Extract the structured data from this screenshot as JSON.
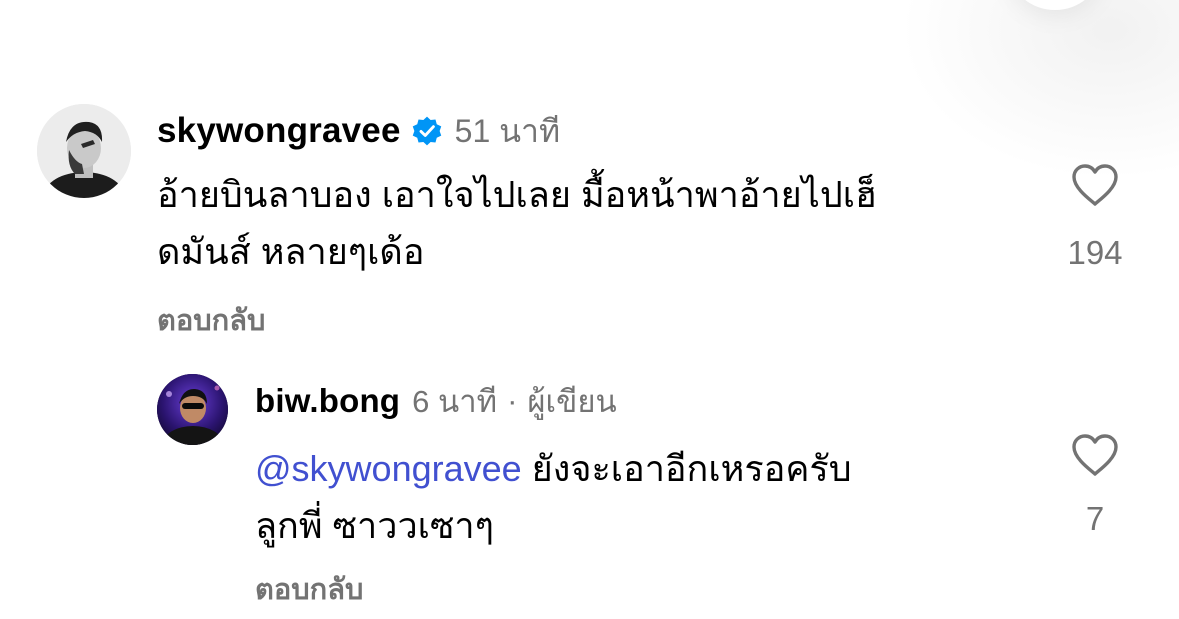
{
  "colors": {
    "text_primary": "#000000",
    "text_secondary": "#737373",
    "mention": "#4150d0",
    "verified_badge": "#0095f6"
  },
  "comment": {
    "username": "skywongravee",
    "verified": true,
    "verified_icon": "verified-badge-icon",
    "time": "51 นาที",
    "text_line1": "อ้ายบินลาบอง เอาใจไปเลย มื้อหน้าพาอ้ายไปเฮ็",
    "text_line2": "ดมันส์ หลายๆเด้อ",
    "reply_label": "ตอบกลับ",
    "like_icon": "heart-outline-icon",
    "like_count": "194"
  },
  "reply": {
    "username": "biw.bong",
    "time": "6 นาที",
    "separator": "·",
    "author_badge": "ผู้เขียน",
    "mention": "@skywongravee",
    "text_line1_rest": " ยังจะเอาอีกเหรอครับ",
    "text_line2": "ลูกพี่ ซาววเซาๆ",
    "reply_label": "ตอบกลับ",
    "like_icon": "heart-outline-icon",
    "like_count": "7"
  }
}
